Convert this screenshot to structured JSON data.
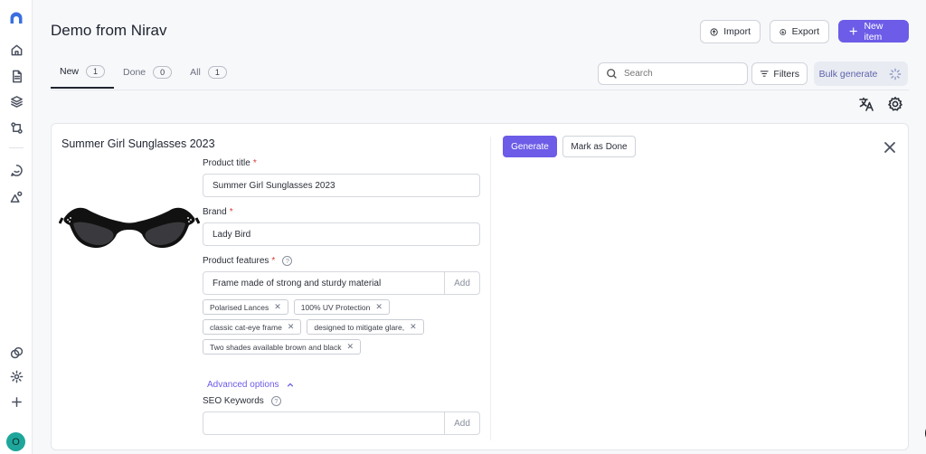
{
  "header": {
    "title": "Demo from Nirav",
    "import_label": "Import",
    "export_label": "Export",
    "new_item_label": "New item"
  },
  "tabs": [
    {
      "label": "New",
      "count": "1"
    },
    {
      "label": "Done",
      "count": "0"
    },
    {
      "label": "All",
      "count": "1"
    }
  ],
  "search": {
    "placeholder": "Search"
  },
  "filters_label": "Filters",
  "bulk_generate_label": "Bulk generate",
  "item": {
    "title": "Summer Girl Sunglasses 2023",
    "generate_label": "Generate",
    "mark_done_label": "Mark as Done",
    "required_marker": "*",
    "help_marker": "?",
    "product_title": {
      "label": "Product title",
      "value": "Summer Girl Sunglasses 2023"
    },
    "brand": {
      "label": "Brand",
      "value": "Lady Bird"
    },
    "features": {
      "label": "Product features",
      "value": "Frame made of strong and sturdy material",
      "add_label": "Add",
      "tags": [
        "Polarised Lances",
        "100% UV Protection",
        "classic cat-eye frame",
        "designed to mitigate glare,",
        "Two shades available brown and black"
      ]
    },
    "advanced_label": "Advanced options",
    "seo": {
      "label": "SEO Keywords",
      "value": "",
      "add_label": "Add"
    }
  },
  "user": {
    "avatar_initial": "O"
  },
  "help_fab": "?",
  "colors": {
    "accent": "#6c5ce7",
    "avatar": "#1ea69b",
    "required": "#d63b3b"
  }
}
